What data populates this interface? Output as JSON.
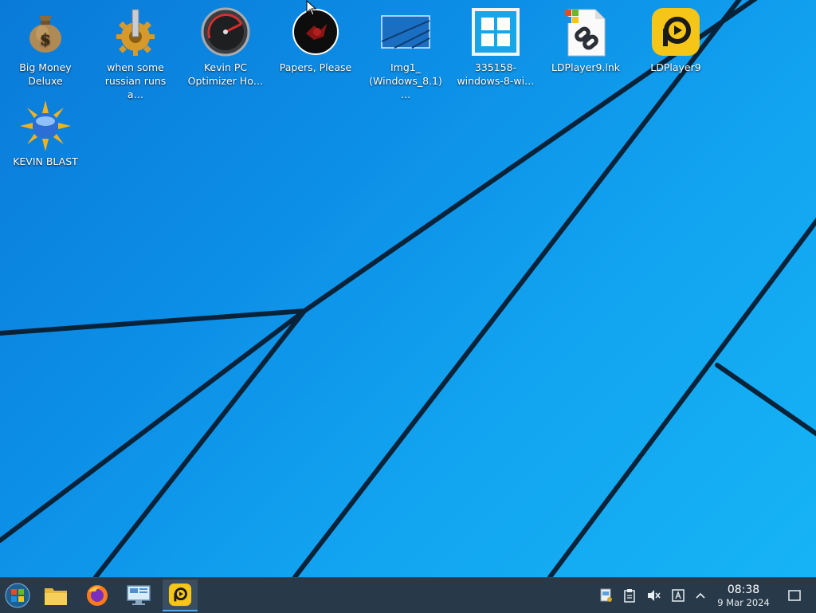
{
  "desktop": {
    "icons": [
      {
        "name": "big-money-deluxe",
        "label": "Big Money\nDeluxe",
        "icon": "money-bag-icon"
      },
      {
        "name": "when-some-russian",
        "label": "when some\nrussian runs a…",
        "icon": "gear-icon"
      },
      {
        "name": "kevin-pc-optimizer",
        "label": "Kevin PC\nOptimizer Ho…",
        "icon": "speedometer-icon"
      },
      {
        "name": "papers-please",
        "label": "Papers, Please",
        "icon": "papers-please-icon"
      },
      {
        "name": "img1-windows",
        "label": "Img1_\n(Windows_8.1)…",
        "icon": "image-icon"
      },
      {
        "name": "windows-8-wallpaper",
        "label": "335158-\nwindows-8-wi…",
        "icon": "windows-logo-icon"
      },
      {
        "name": "ldplayer9-lnk",
        "label": "LDPlayer9.lnk",
        "icon": "shortcut-icon"
      },
      {
        "name": "ldplayer9",
        "label": "LDPlayer9",
        "icon": "ldplayer-icon"
      },
      {
        "name": "kevin-blast",
        "label": "KEVIN BLAST",
        "icon": "sun-globe-icon"
      }
    ]
  },
  "taskbar": {
    "start_icon": "start-orb-icon",
    "pinned": [
      {
        "name": "file-manager",
        "icon": "folder-icon"
      },
      {
        "name": "firefox",
        "icon": "firefox-icon"
      },
      {
        "name": "system-settings",
        "icon": "monitor-settings-icon"
      },
      {
        "name": "ldplayer-running",
        "icon": "ldplayer-icon",
        "active": true
      }
    ],
    "tray": [
      {
        "name": "tray-network",
        "icon": "network-icon"
      },
      {
        "name": "tray-clipboard",
        "icon": "clipboard-icon"
      },
      {
        "name": "tray-volume-muted",
        "icon": "volume-muted-icon"
      },
      {
        "name": "tray-keyboard-layout",
        "icon": "keyboard-layout-icon"
      },
      {
        "name": "tray-expand",
        "icon": "chevron-up-icon"
      }
    ],
    "clock": {
      "time": "08:38",
      "date": "9 Mar 2024"
    },
    "show_desktop_icon": "show-desktop-icon"
  },
  "colors": {
    "wallpaper_blue": "#0c8ee6",
    "taskbar_bg": "#283a4a",
    "ldplayer_yellow": "#f5c518"
  }
}
